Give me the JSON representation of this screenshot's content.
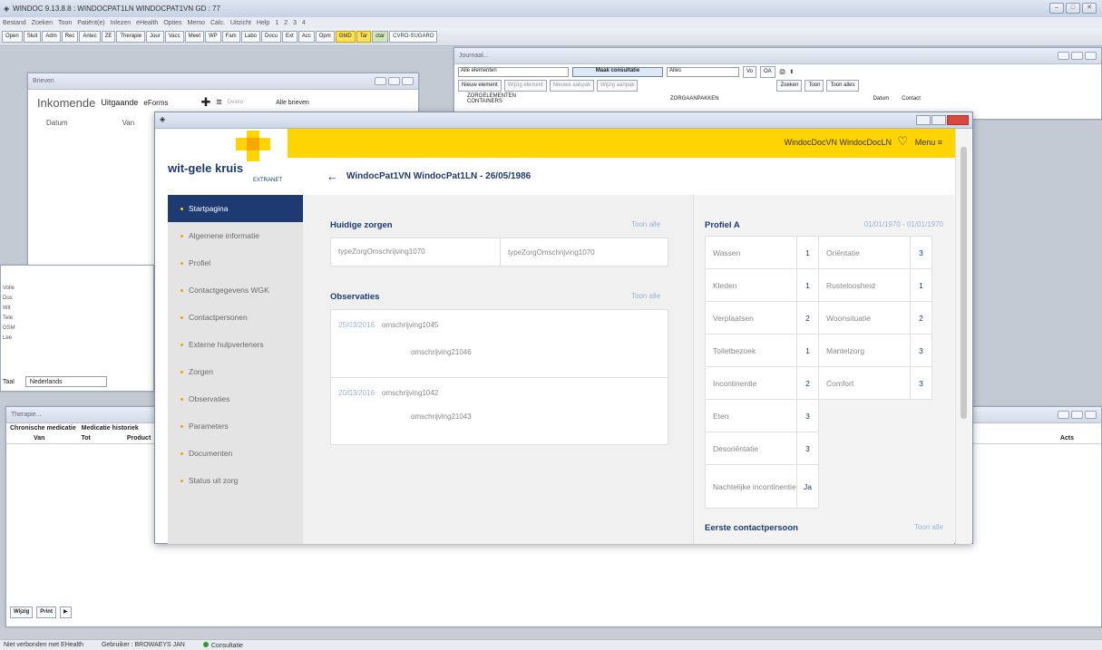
{
  "app": {
    "title": "WINDOC 9.13.8.8 : WINDOCPAT1LN WINDOCPAT1VN GD : 77",
    "menu": [
      "Bestand",
      "Zoeken",
      "Toon",
      "Patiënt(e)",
      "Inlezen",
      "eHealth",
      "Opties",
      "Memo",
      "Calc.",
      "Uitzicht",
      "Help",
      "1",
      "2",
      "3",
      "4"
    ],
    "toolbar": [
      "Open",
      "Sluit",
      "Adm",
      "Rec",
      "Antec",
      "ZE",
      "Therapie",
      "Jour",
      "Vacc",
      "Meet",
      "WP",
      "Fam",
      "Labo",
      "Docu",
      "Ext",
      "Acc",
      "Opm",
      "GMD",
      "Tar",
      "ctar",
      "CVRO-SUGARO"
    ]
  },
  "journal": {
    "title": "Journaal...",
    "filter": "Alle elementen",
    "make_button": "Maak consultatie",
    "alles": "Alles",
    "new_element": "Nieuw element",
    "edit_element": "Wijzig element",
    "new_approach": "Nieuwe aanpak",
    "edit_approach": "Wijzig aanpak",
    "search": "Zoeken",
    "show": "Toon",
    "show_all": "Toon alles",
    "tree1": "ZORGELEMENTEN",
    "tree2": "CONTAINERS",
    "tree3": "ZORGAANPAKKEN",
    "col_datum": "Datum",
    "col_contact": "Contact",
    "btn_vo": "Vo",
    "btn_oa": "OA"
  },
  "brieven": {
    "title": "Brieven",
    "tab_in": "Inkomende",
    "tab_out": "Uitgaande",
    "tab_eforms": "eForms",
    "filter": "Alle brieven",
    "col_datum": "Datum",
    "col_van": "Van",
    "delete": "Delete"
  },
  "patient": {
    "lang_label": "Taal",
    "lang_value": "Nederlands",
    "labels": [
      "Volle",
      "Dos",
      "Wit",
      "Tele",
      "GSM",
      "Lee"
    ]
  },
  "therapie": {
    "title": "Therapie...",
    "tab1": "Chronische medicatie",
    "tab2": "Medicatie historiek",
    "cols": [
      "Van",
      "Tot",
      "Product"
    ],
    "right_col": "Acts",
    "btn_edit": "Wijzig",
    "btn_print": "Print"
  },
  "status": {
    "ehealth": "Niet verbonden met EHealth",
    "user": "Gebruiker : BROWAEYS JAN",
    "mode": "Consultatie"
  },
  "modal": {
    "logo_name": "wit-gele kruis",
    "logo_sub": "EXTRANET",
    "user": "WindocDocVN WindocDocLN",
    "menu": "Menu",
    "page_title": "WindocPat1VN WindocPat1LN - 26/05/1986",
    "nav": [
      "Startpagina",
      "Algemene informatie",
      "Profiel",
      "Contactgegevens WGK",
      "Contactpersonen",
      "Externe hulpverleners",
      "Zorgen",
      "Observaties",
      "Parameters",
      "Documenten",
      "Status uit zorg"
    ],
    "huidige": {
      "title": "Huidige zorgen",
      "toon": "Toon alle",
      "items": [
        "typeZorgOmschrijving1070",
        "typeZorgOmschrijving1070"
      ]
    },
    "observaties": {
      "title": "Observaties",
      "toon": "Toon alle",
      "entries": [
        {
          "date": "25/03/2016",
          "lines": [
            "omschrijving1045",
            "omschrijving21046"
          ]
        },
        {
          "date": "20/03/2016",
          "lines": [
            "omschrijving1042",
            "omschrijving21043"
          ]
        }
      ]
    },
    "profiel": {
      "title": "Profiel A",
      "range": "01/01/1970 - 01/01/1970",
      "left": [
        [
          "Wassen",
          "1"
        ],
        [
          "Kleden",
          "1"
        ],
        [
          "Verplaatsen",
          "2"
        ],
        [
          "Toiletbezoek",
          "1"
        ],
        [
          "Incontinentie",
          "2"
        ],
        [
          "Eten",
          "3"
        ],
        [
          "Desoriëntatie",
          "3"
        ],
        [
          "Nachtelijke incontinentie",
          "Ja"
        ]
      ],
      "right": [
        [
          "Oriëntatie",
          "3"
        ],
        [
          "Rusteloosheid",
          "1"
        ],
        [
          "Woonsituatie",
          "2"
        ],
        [
          "Mantelzorg",
          "3"
        ],
        [
          "Comfort",
          "3"
        ]
      ]
    },
    "contact": {
      "title": "Eerste contactpersoon",
      "toon": "Toon alle"
    }
  }
}
